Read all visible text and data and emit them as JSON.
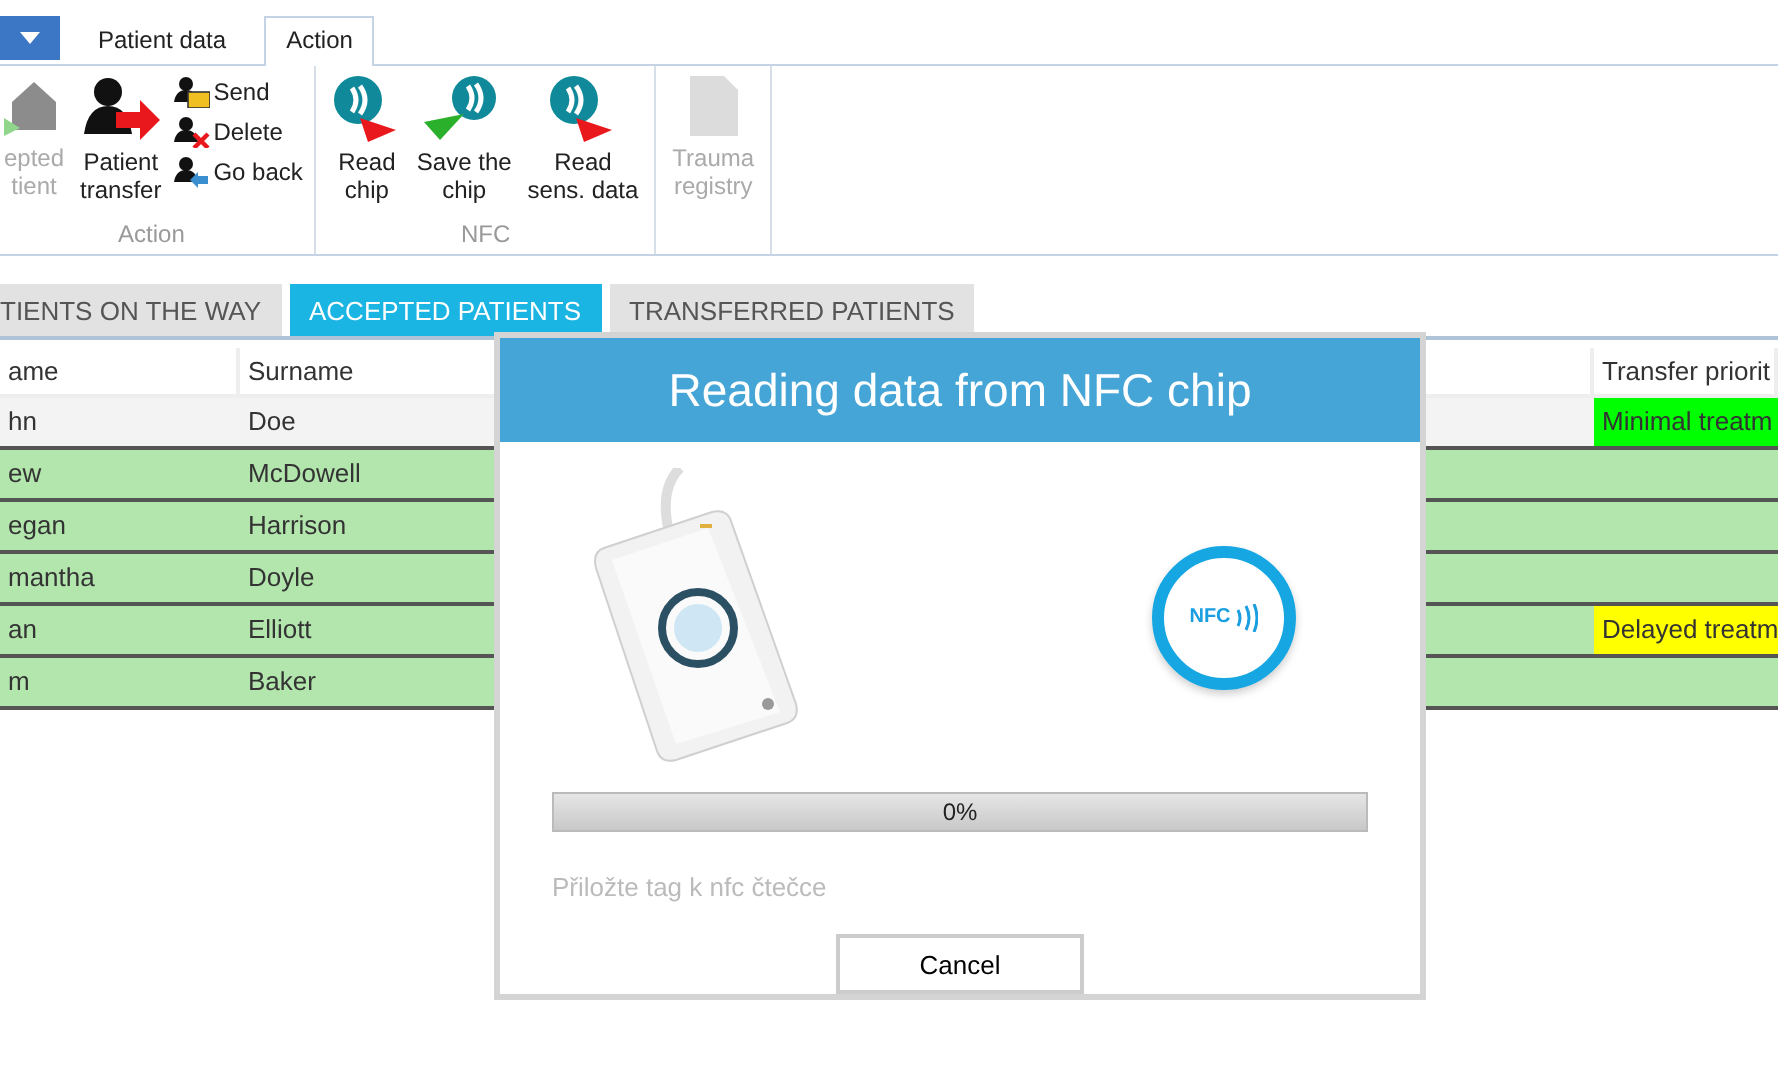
{
  "ribbon_tabs": [
    {
      "label": "Patient data",
      "selected": false
    },
    {
      "label": "Action",
      "selected": true
    }
  ],
  "ribbon_groups": [
    {
      "label": "Action",
      "items": [
        {
          "kind": "large",
          "label": "epted\ntient",
          "disabled": true
        },
        {
          "kind": "large",
          "label": "Patient\ntransfer",
          "disabled": false
        },
        {
          "kind": "stack",
          "buttons": [
            {
              "label": "Send"
            },
            {
              "label": "Delete"
            },
            {
              "label": "Go back"
            }
          ]
        }
      ]
    },
    {
      "label": "NFC",
      "items": [
        {
          "kind": "large",
          "label": "Read\nchip",
          "disabled": false
        },
        {
          "kind": "large",
          "label": "Save the\nchip",
          "disabled": false
        },
        {
          "kind": "large",
          "label": "Read\nsens. data",
          "disabled": false
        }
      ]
    },
    {
      "items": [
        {
          "kind": "large",
          "label": "Trauma\nregistry",
          "disabled": true
        }
      ]
    }
  ],
  "list_tabs": [
    {
      "label": "TIENTS ON THE WAY",
      "selected": false
    },
    {
      "label": "ACCEPTED PATIENTS",
      "selected": true
    },
    {
      "label": "TRANSFERRED PATIENTS",
      "selected": false
    }
  ],
  "table": {
    "columns": [
      "ame",
      "Surname",
      "Transfer priorit"
    ],
    "rows": [
      {
        "name": "hn",
        "surname": "Doe",
        "priority": "Minimal treatm",
        "color": "#00ff00",
        "selected": true
      },
      {
        "name": "ew",
        "surname": "McDowell",
        "selected": false
      },
      {
        "name": "egan",
        "surname": "Harrison",
        "selected": false
      },
      {
        "name": "mantha",
        "surname": "Doyle",
        "selected": false
      },
      {
        "name": "an",
        "surname": "Elliott",
        "priority": "Delayed treatm",
        "color": "#ffff00",
        "selected": false
      },
      {
        "name": "m",
        "surname": "Baker",
        "selected": false
      }
    ]
  },
  "dialog": {
    "title": "Reading data from NFC chip",
    "nfc_badge": "NFC",
    "progress": {
      "level": 0,
      "reading": "0%"
    },
    "hint": "Přiložte tag k nfc čtečce",
    "buttons": [
      "Cancel"
    ]
  }
}
